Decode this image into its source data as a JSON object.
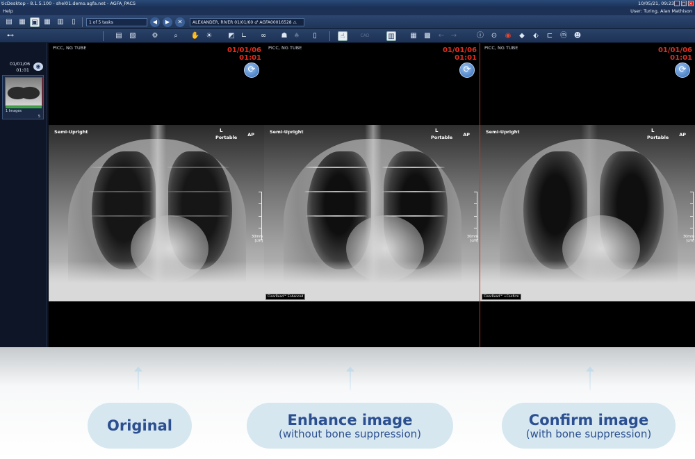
{
  "titlebar": {
    "title": "ticDesktop - 8.1.5.100 - shel01.demo.agfa.net - AGFA_PACS",
    "datetime": "10/05/21, 09:23"
  },
  "menubar": {
    "menu_help": "Help",
    "user": "User: Turing, Alan Mathison"
  },
  "toolbar1": {
    "task_selector": "1 of 5 tasks",
    "patient_info": "ALEXANDER, RIVER 01/01/60 ♂ AGFA00016528 ⚠"
  },
  "toolbar2": {
    "cad_label": "CAD"
  },
  "sidebar": {
    "study_date": "01/01/06",
    "study_time": "01:01",
    "thumbnail_label": "1  Images",
    "thumbnail_count": "5"
  },
  "viewports": [
    {
      "top_left": "PICC, NG TUBE",
      "date": "01/01/06",
      "time": "01:01",
      "semi_upright": "Semi-Upright",
      "marker_L": "L",
      "portable": "Portable",
      "ap": "AP",
      "tag": "",
      "scale": "30mm\n[cm]"
    },
    {
      "top_left": "PICC, NG TUBE",
      "date": "01/01/06",
      "time": "01:01",
      "semi_upright": "Semi-Upright",
      "marker_L": "L",
      "portable": "Portable",
      "ap": "AP",
      "tag": "ClearRead™ Enhanced",
      "scale": "30mm\n[cm]"
    },
    {
      "top_left": "PICC, NG TUBE",
      "date": "01/01/06",
      "time": "01:01",
      "semi_upright": "Semi-Upright",
      "marker_L": "L",
      "portable": "Portable",
      "ap": "AP",
      "tag": "ClearRead™ +Confirm",
      "scale": "30mm\n[cm]"
    }
  ],
  "captions": [
    {
      "main": "Original",
      "sub": ""
    },
    {
      "main": "Enhance image",
      "sub": "(without bone suppression)"
    },
    {
      "main": "Confirm image",
      "sub": "(with bone suppression)"
    }
  ],
  "colors": {
    "date_red": "#e0301e",
    "pill_bg": "#d6e7f0",
    "pill_text": "#2b4f90",
    "toolbar": "#1f3558"
  }
}
